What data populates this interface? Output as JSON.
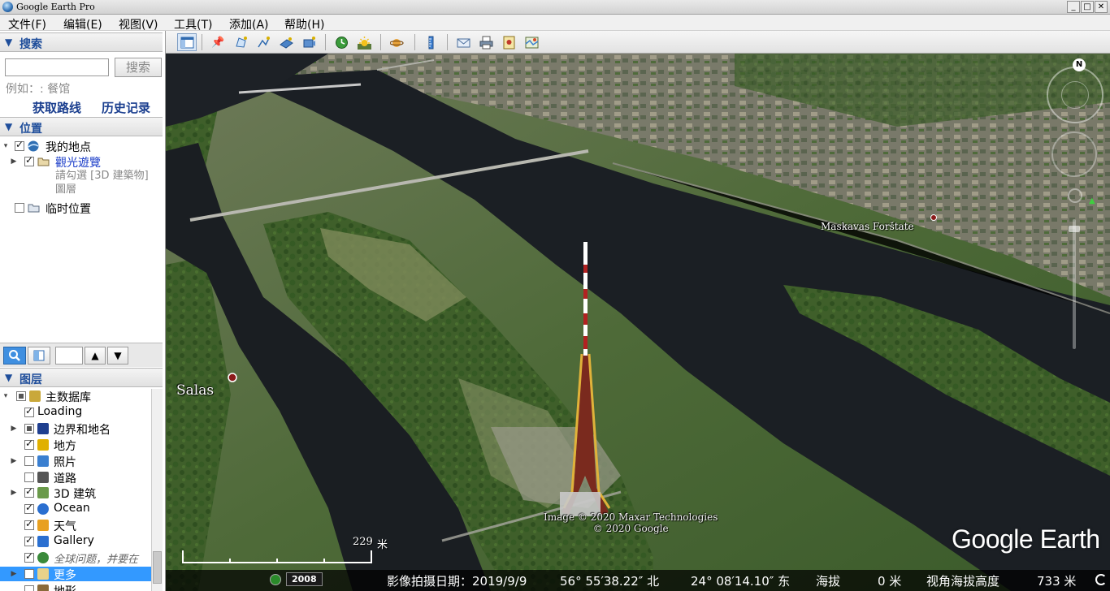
{
  "window": {
    "title": "Google Earth Pro",
    "minimize": "_",
    "maximize": "□",
    "close": "✕"
  },
  "menu": [
    "文件(F)",
    "编辑(E)",
    "视图(V)",
    "工具(T)",
    "添加(A)",
    "帮助(H)"
  ],
  "search": {
    "header": "搜索",
    "input_value": "",
    "button": "搜索",
    "hint": "例如：: 餐馆",
    "link_directions": "获取路线",
    "link_history": "历史记录"
  },
  "places": {
    "header": "位置",
    "items": [
      {
        "label": "我的地点",
        "checked": true,
        "icon": "my-places-icon"
      },
      {
        "label": "觀光遊覽",
        "checked": true,
        "icon": "folder-icon",
        "note": "請勾選 [3D 建築物] 圖層"
      },
      {
        "label": "临时位置",
        "checked": false,
        "icon": "folder-icon"
      }
    ]
  },
  "layers": {
    "header": "图层",
    "items": [
      {
        "label": "主数据库",
        "state": "partial",
        "icon": "database-icon"
      },
      {
        "label": "Loading",
        "state": "checked",
        "icon": ""
      },
      {
        "label": "边界和地名",
        "state": "partial",
        "icon": "borders-icon"
      },
      {
        "label": "地方",
        "state": "checked",
        "icon": "places-icon"
      },
      {
        "label": "照片",
        "state": "unchecked",
        "icon": "photos-icon"
      },
      {
        "label": "道路",
        "state": "unchecked",
        "icon": "roads-icon"
      },
      {
        "label": "3D 建筑",
        "state": "checked",
        "icon": "buildings-3d-icon"
      },
      {
        "label": "Ocean",
        "state": "checked",
        "icon": "ocean-icon"
      },
      {
        "label": "天气",
        "state": "checked",
        "icon": "weather-icon"
      },
      {
        "label": "Gallery",
        "state": "checked",
        "icon": "gallery-icon"
      },
      {
        "label": "全球问题，并要在",
        "state": "checked",
        "icon": "global-awareness-icon"
      },
      {
        "label": "更多",
        "state": "unchecked",
        "icon": "more-icon",
        "selected": true
      },
      {
        "label": "地形",
        "state": "unchecked",
        "icon": "terrain-icon"
      }
    ]
  },
  "toolbar": [
    "hide-sidebar-icon",
    "placemark-icon",
    "polygon-icon",
    "path-icon",
    "image-overlay-icon",
    "record-tour-icon",
    "historical-imagery-icon",
    "sunlight-icon",
    "planets-icon",
    "ruler-icon",
    "email-icon",
    "print-icon",
    "save-image-icon",
    "view-in-maps-icon"
  ],
  "map": {
    "labels": {
      "salas": "Salas",
      "maskavas": "Maskavas Forštate"
    },
    "attribution": [
      "Image © 2020 Maxar Technologies",
      "© 2020 Google"
    ],
    "logo": "Google Earth",
    "scale": {
      "value": "229",
      "unit": "米"
    },
    "north": "N"
  },
  "status": {
    "year": "2008",
    "imagery_date": "影像拍摄日期：2019/9/9",
    "lat": "56° 55′38.22″ 北",
    "lon": "24° 08′14.10″ 东",
    "elev_label": "海拔",
    "elev_value": "0 米",
    "eye_label": "视角海拔高度",
    "eye_value": "733 米"
  },
  "colors": {
    "panel_header_text": "#1f4e9b",
    "link": "#1b3f8f",
    "selection": "#3399ff",
    "river": "#1b1f24"
  }
}
